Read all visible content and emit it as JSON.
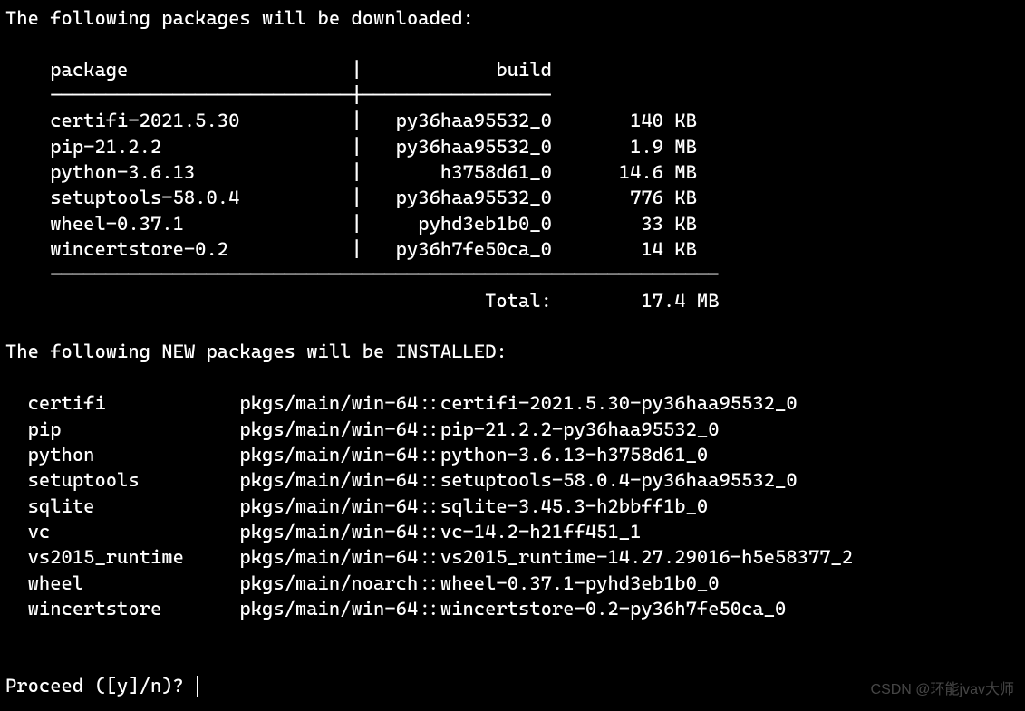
{
  "header_download": "The following packages will be downloaded:",
  "dl_table": {
    "col_package": "package",
    "col_build": "build",
    "rows": [
      {
        "package": "certifi-2021.5.30",
        "build": "py36haa95532_0",
        "size": "140 KB"
      },
      {
        "package": "pip-21.2.2",
        "build": "py36haa95532_0",
        "size": "1.9 MB"
      },
      {
        "package": "python-3.6.13",
        "build": "h3758d61_0",
        "size": "14.6 MB"
      },
      {
        "package": "setuptools-58.0.4",
        "build": "py36haa95532_0",
        "size": "776 KB"
      },
      {
        "package": "wheel-0.37.1",
        "build": "pyhd3eb1b0_0",
        "size": "33 KB"
      },
      {
        "package": "wincertstore-0.2",
        "build": "py36h7fe50ca_0",
        "size": "14 KB"
      }
    ],
    "total_label": "Total:",
    "total_value": "17.4 MB"
  },
  "header_install": "The following NEW packages will be INSTALLED:",
  "install_rows": [
    {
      "name": "certifi",
      "spec": "pkgs/main/win-64::certifi-2021.5.30-py36haa95532_0"
    },
    {
      "name": "pip",
      "spec": "pkgs/main/win-64::pip-21.2.2-py36haa95532_0"
    },
    {
      "name": "python",
      "spec": "pkgs/main/win-64::python-3.6.13-h3758d61_0"
    },
    {
      "name": "setuptools",
      "spec": "pkgs/main/win-64::setuptools-58.0.4-py36haa95532_0"
    },
    {
      "name": "sqlite",
      "spec": "pkgs/main/win-64::sqlite-3.45.3-h2bbff1b_0"
    },
    {
      "name": "vc",
      "spec": "pkgs/main/win-64::vc-14.2-h21ff451_1"
    },
    {
      "name": "vs2015_runtime",
      "spec": "pkgs/main/win-64::vs2015_runtime-14.27.29016-h5e58377_2"
    },
    {
      "name": "wheel",
      "spec": "pkgs/main/noarch::wheel-0.37.1-pyhd3eb1b0_0"
    },
    {
      "name": "wincertstore",
      "spec": "pkgs/main/win-64::wincertstore-0.2-py36h7fe50ca_0"
    }
  ],
  "prompt": "Proceed ([y]/n)? ",
  "watermark": "CSDN @环能jvav大师"
}
